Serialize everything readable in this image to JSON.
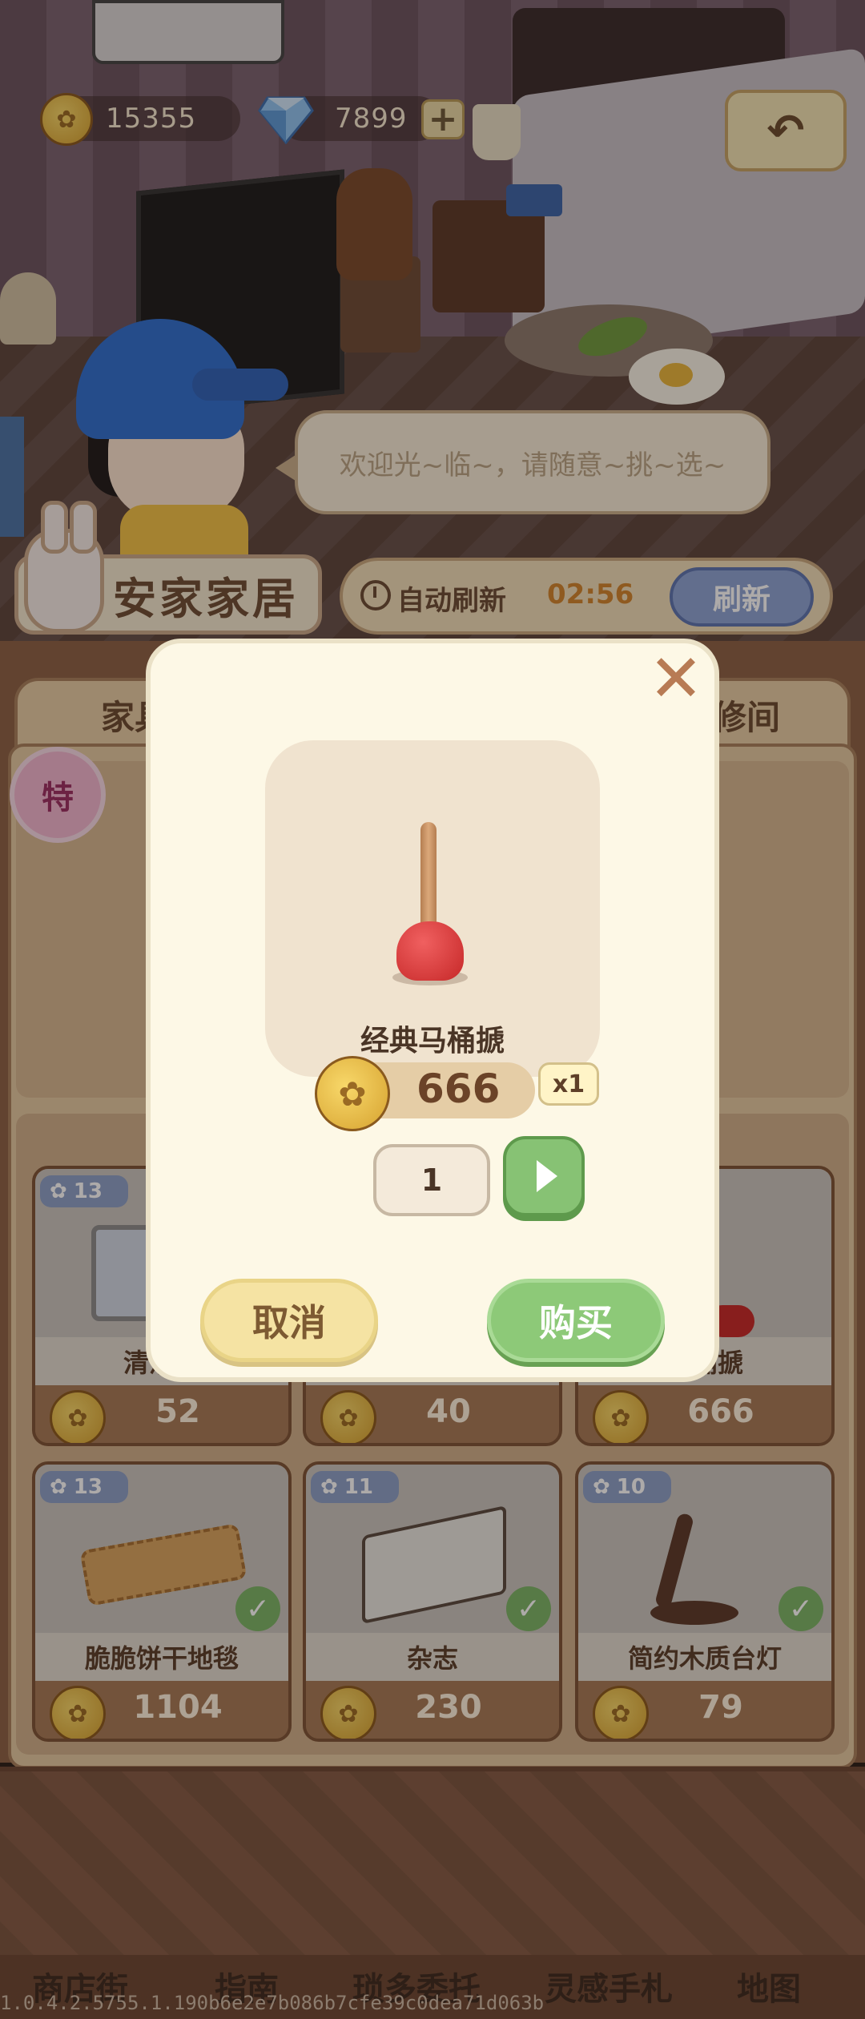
{
  "hud": {
    "coins": "15355",
    "diamonds": "7899",
    "plus_label": "+",
    "back_icon": "↶"
  },
  "shopkeeper": {
    "greeting": "欢迎光~临~，请随意~挑~选~"
  },
  "shop": {
    "name": "安家家居",
    "auto_refresh_label": "自动刷新",
    "refresh_timer": "02:56",
    "refresh_button": "刷新",
    "special_badge": "特",
    "tabs": [
      "家具",
      "装修间"
    ]
  },
  "items": [
    {
      "level": "13",
      "name": "清洁用",
      "price": "52",
      "owned": false
    },
    {
      "level": "",
      "name": "",
      "price": "40",
      "owned": false
    },
    {
      "level": "",
      "name": "马桶搋",
      "price": "666",
      "owned": false
    },
    {
      "level": "13",
      "name": "脆脆饼干地毯",
      "price": "1104",
      "owned": true
    },
    {
      "level": "11",
      "name": "杂志",
      "price": "230",
      "owned": true
    },
    {
      "level": "10",
      "name": "简约木质台灯",
      "price": "79",
      "owned": true
    }
  ],
  "modal": {
    "close_icon": "✕",
    "item_name": "经典马桶搋",
    "price": "666",
    "multiplier": "x1",
    "quantity": "1",
    "cancel_label": "取消",
    "buy_label": "购买"
  },
  "nav": [
    "商店街",
    "指南",
    "琐多委托",
    "灵感手札",
    "地图"
  ],
  "build_id": "1.0.4.2.5755.1.190b6e2e7b086b7cfe39c0dea71d063b",
  "colors": {
    "accent_green": "#8dc978",
    "accent_yellow": "#f5e3a3",
    "timer_orange": "#d1842d",
    "panel_brown": "#8c6246"
  }
}
